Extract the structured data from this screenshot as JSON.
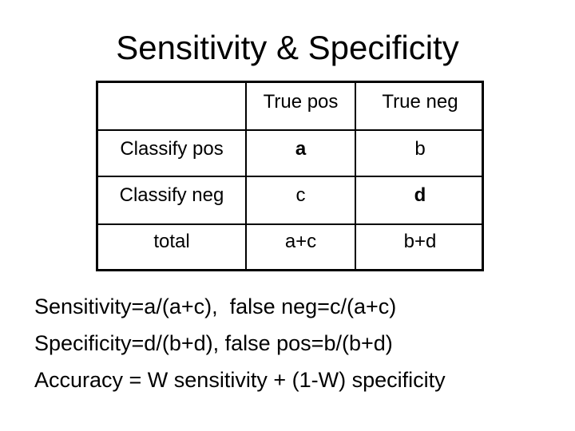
{
  "title": "Sensitivity & Specificity",
  "table": {
    "header": [
      "",
      "True pos",
      "True neg"
    ],
    "rows": [
      {
        "label": "Classify pos",
        "cells": [
          "a",
          "b"
        ]
      },
      {
        "label": "Classify neg",
        "cells": [
          "c",
          "d"
        ]
      },
      {
        "label": "total",
        "cells": [
          "a+c",
          "b+d"
        ]
      }
    ]
  },
  "formulas": [
    "Sensitivity=a/(a+c),  false neg=c/(a+c)",
    "Specificity=d/(b+d), false pos=b/(b+d)",
    "Accuracy = W sensitivity + (1-W) specificity"
  ]
}
